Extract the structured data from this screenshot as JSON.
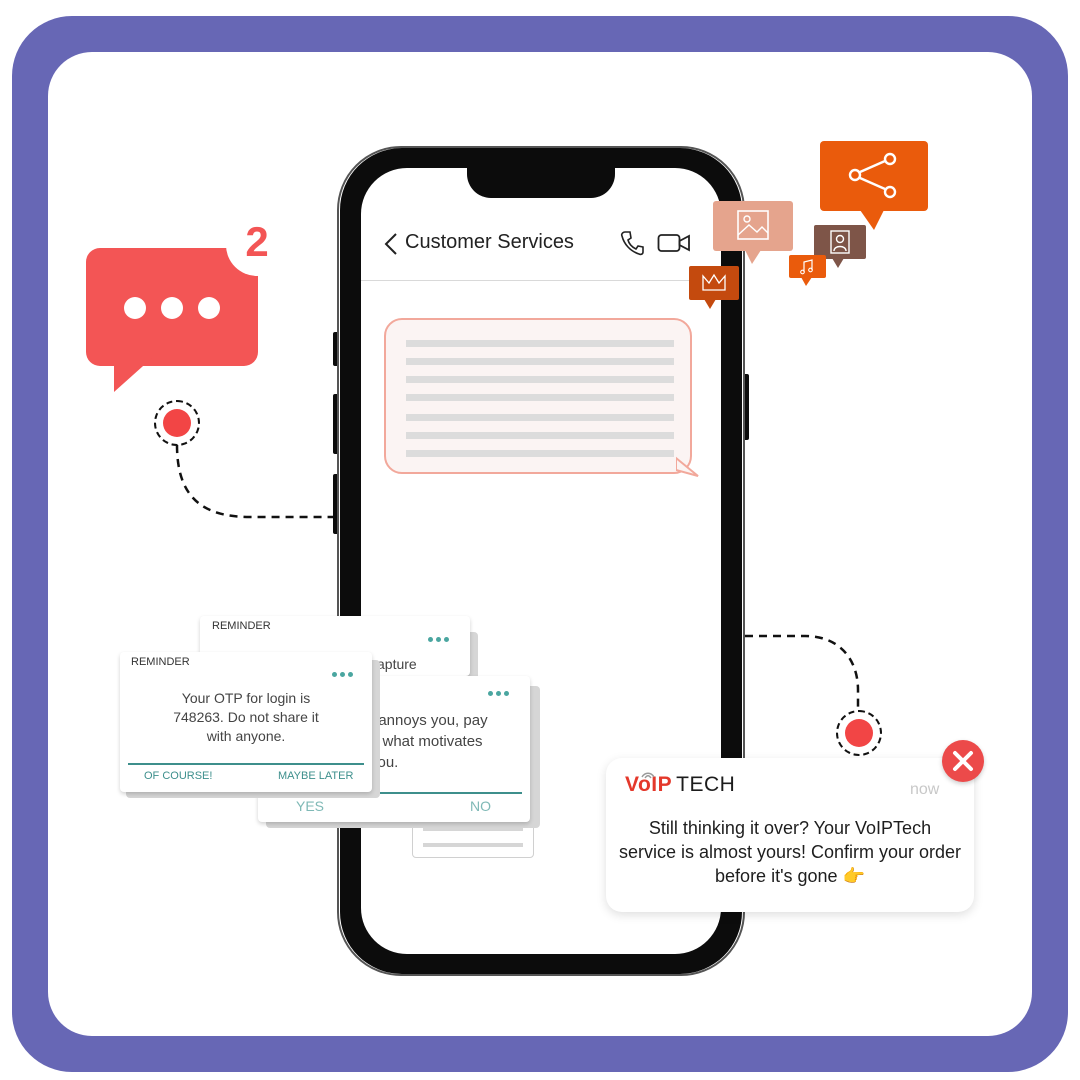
{
  "colors": {
    "frame": "#6767b5",
    "accent_red": "#f35555",
    "orange": "#ea5b0c",
    "teal": "#3d8f8c"
  },
  "chat_badge": {
    "count": "2",
    "icon": "chat-bubble-icon"
  },
  "phone": {
    "header_title": "Customer Services",
    "back_icon": "chevron-left-icon",
    "call_icon": "phone-icon",
    "video_icon": "video-camera-icon"
  },
  "floating_icons": [
    "share-icon",
    "image-icon",
    "contact-icon",
    "music-icon",
    "crown-icon"
  ],
  "notifications": {
    "back_card": {
      "label": "REMINDER",
      "text": "capture"
    },
    "middle_card": {
      "text": "t annoys you, pay\no what motivates\nyou.",
      "action_yes": "YES",
      "action_no": "NO"
    },
    "front_card": {
      "label": "REMINDER",
      "text": "Your OTP for login is 748263. Do not share it with anyone.",
      "action_primary": "OF COURSE!",
      "action_secondary": "MAYBE LATER"
    }
  },
  "voip_card": {
    "brand_main": "VoIP",
    "brand_sub": "TECH",
    "time": "now",
    "message": "Still thinking it over? Your VoIPTech service is almost yours! Confirm your order before it's gone 👉"
  }
}
